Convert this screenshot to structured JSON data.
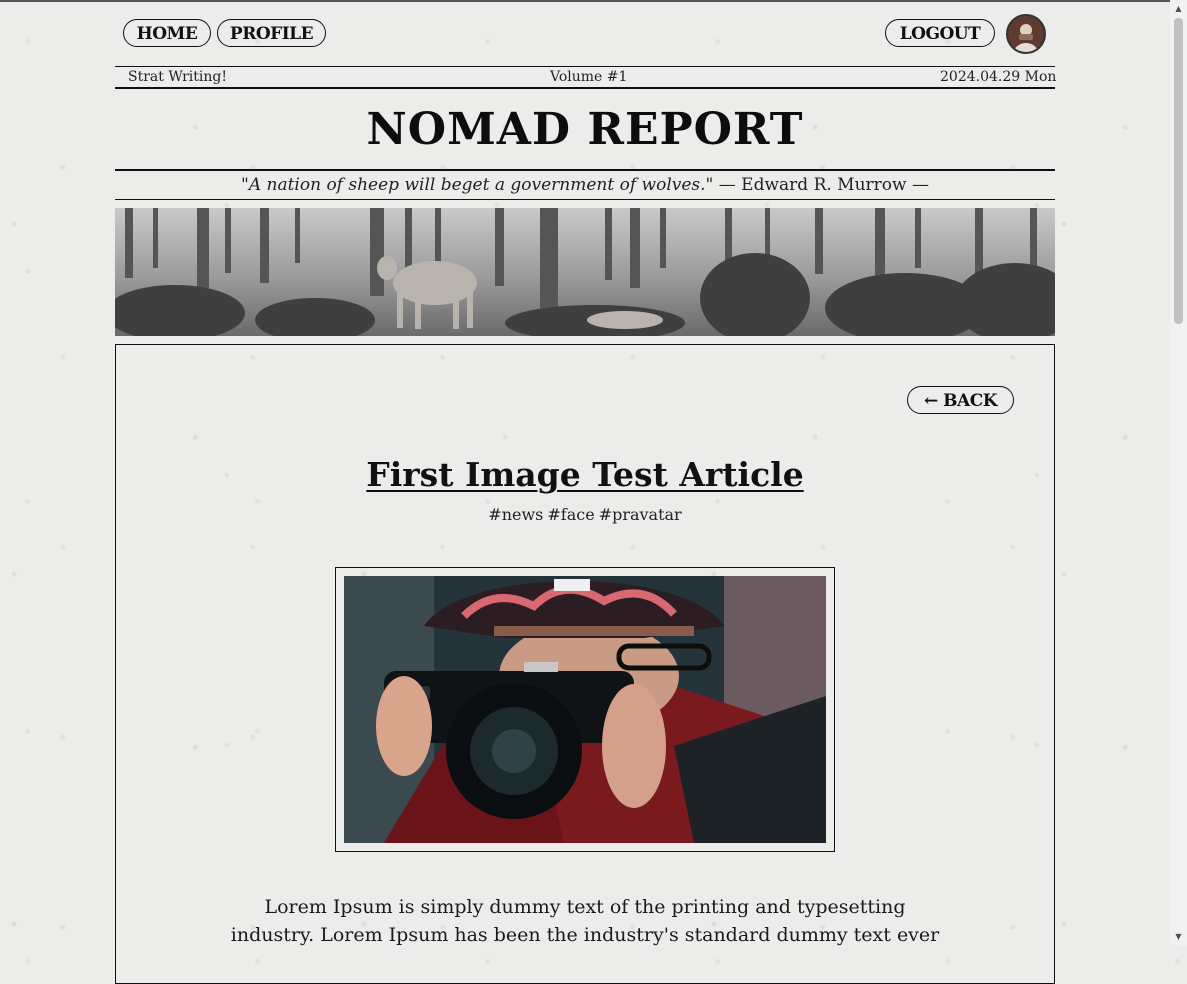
{
  "nav": {
    "home_label": "HOME",
    "profile_label": "PROFILE",
    "logout_label": "LOGOUT"
  },
  "meta": {
    "tagline": "Strat Writing!",
    "volume": "Volume #1",
    "date": "2024.04.29 Mon"
  },
  "masthead": {
    "title": "NOMAD REPORT",
    "quote": "\"A nation of sheep will beget a government of wolves.\"",
    "attribution": "— Edward R. Murrow —"
  },
  "article": {
    "back_label": "← BACK",
    "title": "First Image Test Article",
    "tags": [
      "#news",
      "#face",
      "#pravatar"
    ],
    "body_line1": "Lorem Ipsum is simply dummy text of the printing and typesetting",
    "body_line2": "industry. Lorem Ipsum has been the industry's standard dummy text ever"
  },
  "icons": {
    "avatar": "user-avatar",
    "scroll_up": "chevron-up-icon",
    "scroll_down": "chevron-down-icon"
  },
  "colors": {
    "ink": "#111111",
    "paper": "#ececea"
  }
}
